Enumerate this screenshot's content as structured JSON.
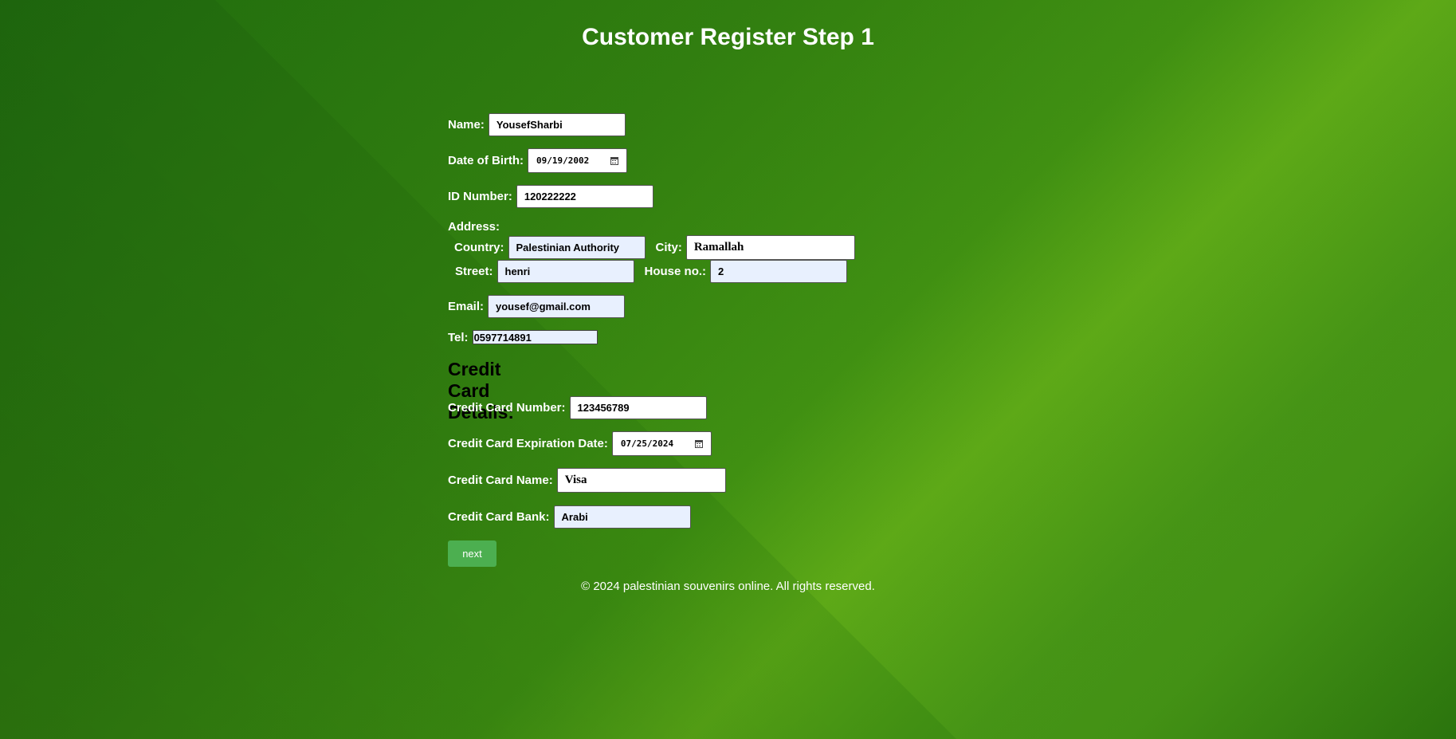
{
  "page": {
    "title": "Customer Register Step 1",
    "footer": "© 2024 palestinian souvenirs online. All rights reserved."
  },
  "form": {
    "name": {
      "label": "Name:",
      "value": "YousefSharbi"
    },
    "dob": {
      "label": "Date of Birth:",
      "value": "09/19/2002"
    },
    "id_number": {
      "label": "ID Number:",
      "value": "120222222"
    },
    "address": {
      "label": "Address:",
      "country": {
        "label": "Country:",
        "value": "Palestinian Authority"
      },
      "city": {
        "label": "City:",
        "value": "Ramallah"
      },
      "street": {
        "label": "Street:",
        "value": "henri"
      },
      "house_no": {
        "label": "House no.:",
        "value": "2"
      }
    },
    "email": {
      "label": "Email:",
      "value": "yousef@gmail.com"
    },
    "tel": {
      "label": "Tel:",
      "value": "0597714891"
    },
    "credit_card": {
      "heading": "Credit Card Details:",
      "number": {
        "label": "Credit Card Number:",
        "value": "123456789"
      },
      "expiration": {
        "label": "Credit Card Expiration Date:",
        "value": "07/25/2024"
      },
      "name": {
        "label": "Credit Card Name:",
        "value": "Visa"
      },
      "bank": {
        "label": "Credit Card Bank:",
        "value": "Arabi"
      }
    },
    "next_label": "next"
  },
  "colors": {
    "background": "#2d7a0e",
    "button": "#4caf50",
    "autofill": "#e8f0fe"
  }
}
